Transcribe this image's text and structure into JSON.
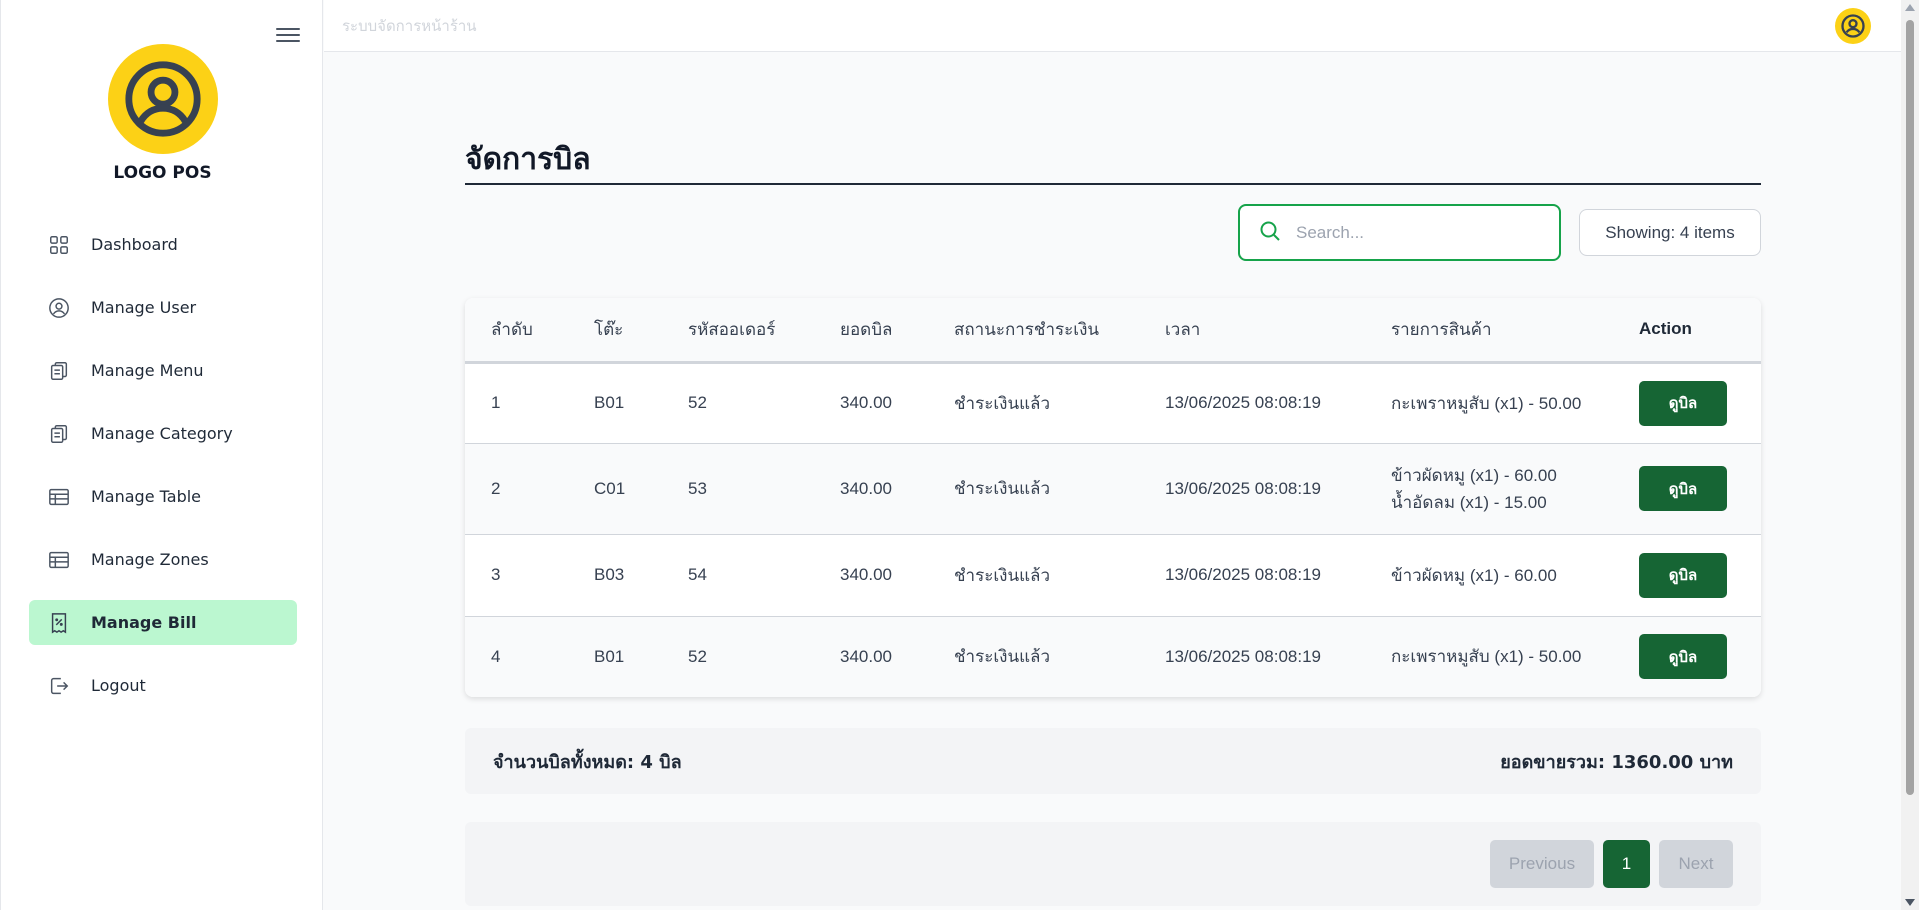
{
  "app": {
    "header_title": "ระบบจัดการหน้าร้าน",
    "logo_text": "LOGO POS"
  },
  "colors": {
    "accent_green": "#166534",
    "active_nav": "#bbf7d0",
    "logo_yellow": "#fcd116",
    "search_border": "#16a34a"
  },
  "sidebar": {
    "items": [
      {
        "label": "Dashboard",
        "icon": "grid-icon"
      },
      {
        "label": "Manage User",
        "icon": "user-circle-icon"
      },
      {
        "label": "Manage Menu",
        "icon": "clipboard-icon"
      },
      {
        "label": "Manage Category",
        "icon": "clipboard-icon"
      },
      {
        "label": "Manage Table",
        "icon": "table-icon"
      },
      {
        "label": "Manage Zones",
        "icon": "table-icon"
      },
      {
        "label": "Manage Bill",
        "icon": "receipt-icon",
        "active": true
      },
      {
        "label": "Logout",
        "icon": "logout-icon"
      }
    ]
  },
  "main": {
    "title": "จัดการบิล",
    "search": {
      "placeholder": "Search...",
      "value": ""
    },
    "showing_label": "Showing: 4 items",
    "table": {
      "headers": [
        "ลำดับ",
        "โต๊ะ",
        "รหัสออเดอร์",
        "ยอดบิล",
        "สถานะการชำระเงิน",
        "เวลา",
        "รายการสินค้า",
        "Action"
      ],
      "rows": [
        {
          "no": "1",
          "table": "B01",
          "order": "52",
          "amount": "340.00",
          "status": "ชำระเงินแล้ว",
          "time": "13/06/2025 08:08:19",
          "items": [
            "กะเพราหมูสับ (x1) - 50.00"
          ],
          "action": "ดูบิล"
        },
        {
          "no": "2",
          "table": "C01",
          "order": "53",
          "amount": "340.00",
          "status": "ชำระเงินแล้ว",
          "time": "13/06/2025 08:08:19",
          "items": [
            "ข้าวผัดหมู (x1) - 60.00",
            "น้ำอัดลม (x1) - 15.00"
          ],
          "action": "ดูบิล"
        },
        {
          "no": "3",
          "table": "B03",
          "order": "54",
          "amount": "340.00",
          "status": "ชำระเงินแล้ว",
          "time": "13/06/2025 08:08:19",
          "items": [
            "ข้าวผัดหมู (x1) - 60.00"
          ],
          "action": "ดูบิล"
        },
        {
          "no": "4",
          "table": "B01",
          "order": "52",
          "amount": "340.00",
          "status": "ชำระเงินแล้ว",
          "time": "13/06/2025 08:08:19",
          "items": [
            "กะเพราหมูสับ (x1) - 50.00"
          ],
          "action": "ดูบิล"
        }
      ]
    },
    "summary": {
      "bill_count": "จำนวนบิลทั้งหมด: 4 บิล",
      "total_sales": "ยอดขายรวม: 1360.00 บาท"
    },
    "pagination": {
      "previous": "Previous",
      "current": "1",
      "next": "Next"
    }
  }
}
